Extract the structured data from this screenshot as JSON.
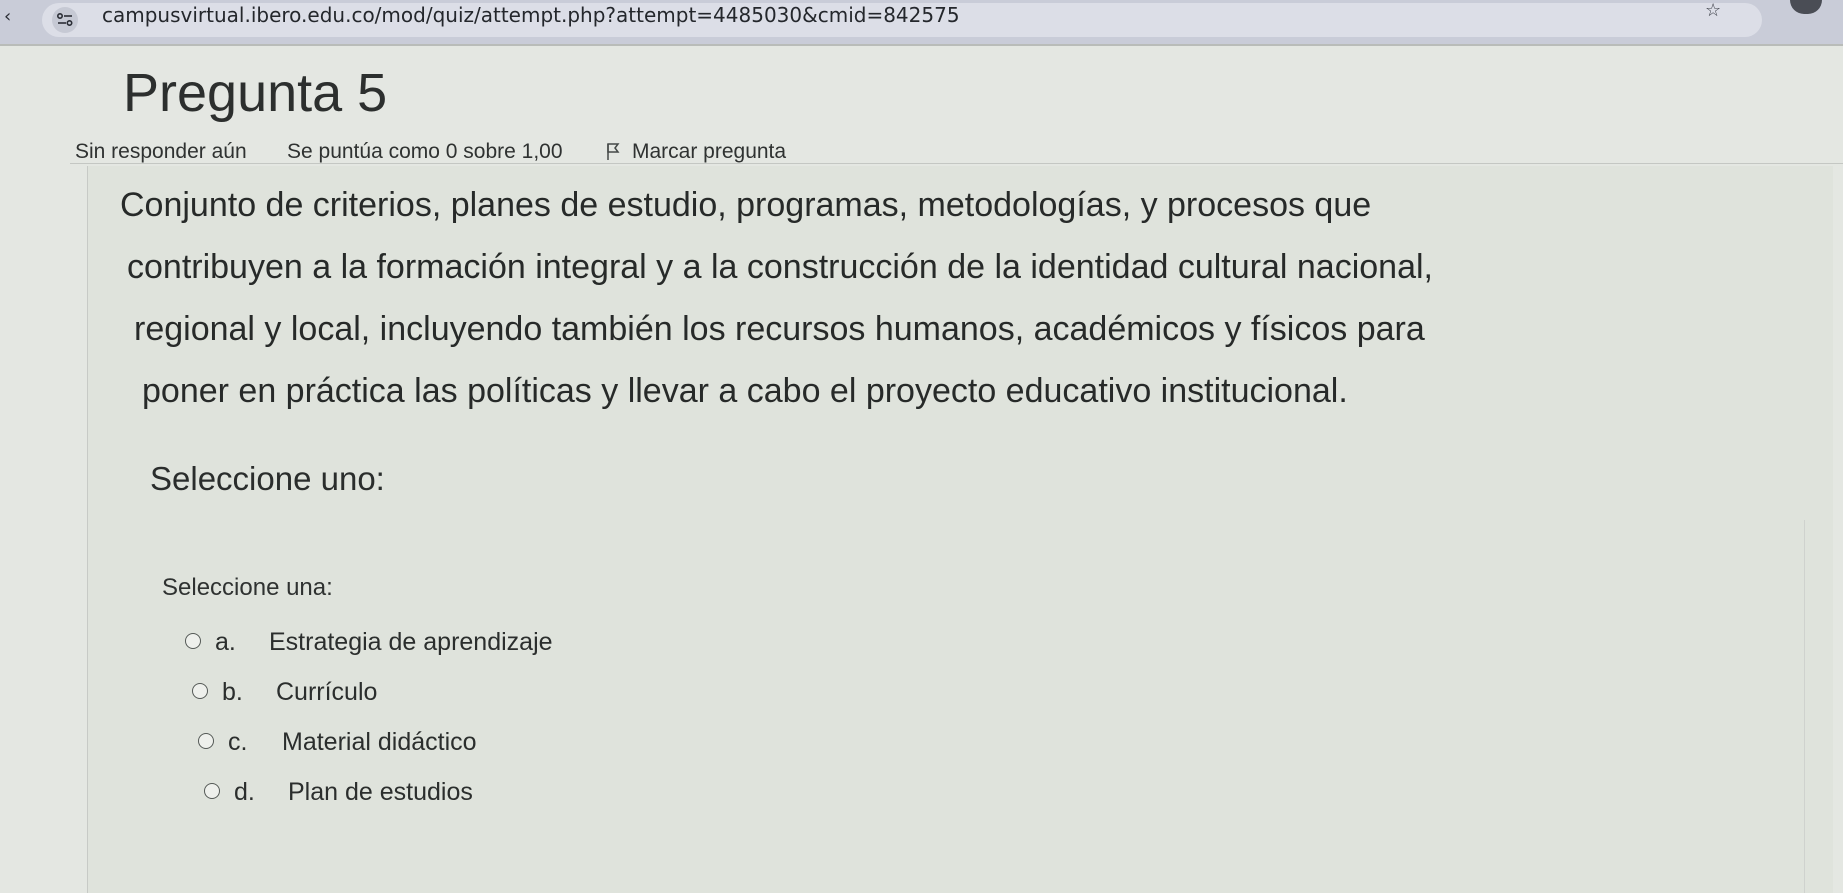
{
  "browser": {
    "url": "campusvirtual.ibero.edu.co/mod/quiz/attempt.php?attempt=4485030&cmid=842575",
    "icons": [
      "back-arrow-icon",
      "site-info-icon",
      "bookmark-star-icon",
      "profile-avatar-icon"
    ]
  },
  "question": {
    "title": "Pregunta 5",
    "state": "Sin responder aún",
    "grade": "Se puntúa como 0 sobre 1,00",
    "flag_label": "Marcar pregunta",
    "text_lines": [
      "Conjunto de criterios, planes de estudio, programas, metodologías, y procesos que",
      "contribuyen a la formación integral y a la construcción de la identidad cultural nacional,",
      "regional y local, incluyendo también los recursos humanos, académicos y físicos para",
      "poner en práctica las políticas y llevar a cabo el proyecto educativo institucional."
    ],
    "prompt": "Seleccione uno:",
    "select_label": "Seleccione una:",
    "options": [
      {
        "letter": "a.",
        "text": "Estrategia de aprendizaje",
        "selected": false
      },
      {
        "letter": "b.",
        "text": "Currículo",
        "selected": false
      },
      {
        "letter": "c.",
        "text": "Material didáctico",
        "selected": false
      },
      {
        "letter": "d.",
        "text": "Plan de estudios",
        "selected": false
      }
    ]
  }
}
